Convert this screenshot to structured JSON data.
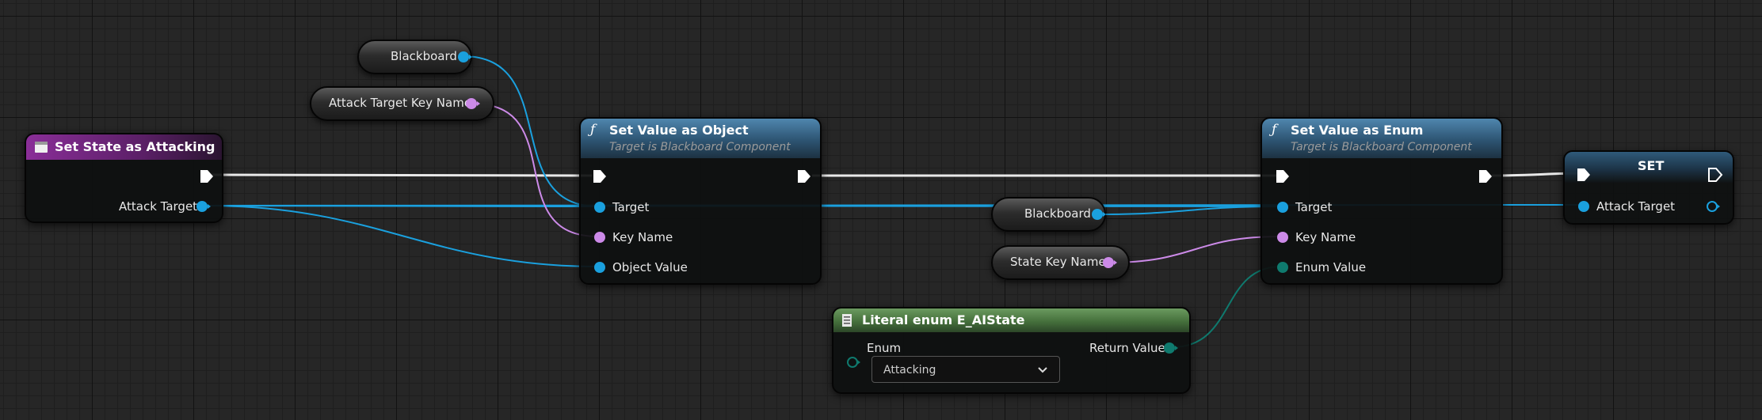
{
  "graph": {
    "colors": {
      "exec": "#e9e9e9",
      "object": "#1aa0de",
      "name": "#cc8ae8",
      "enum": "#0f7a6e",
      "custom_event_header": "#7a2a86",
      "function_header": "#3d6e90",
      "literal_enum_header": "#4e7a44"
    },
    "nodes": {
      "event": {
        "title": "Set State as Attacking",
        "icon": "event-icon",
        "output_pin": "Attack Target"
      },
      "blackboard_var_1": {
        "label": "Blackboard"
      },
      "attack_key_var": {
        "label": "Attack Target Key Name"
      },
      "set_object": {
        "title": "Set Value as Object",
        "subtitle": "Target is Blackboard Component",
        "icon": "function-icon",
        "pins": [
          "Target",
          "Key Name",
          "Object Value"
        ]
      },
      "blackboard_var_2": {
        "label": "Blackboard"
      },
      "state_key_var": {
        "label": "State Key Name"
      },
      "literal_enum": {
        "title": "Literal enum E_AIState",
        "icon": "enum-literal-icon",
        "input_pin": "Enum",
        "output_pin": "Return Value",
        "selected": "Attacking"
      },
      "set_enum": {
        "title": "Set Value as Enum",
        "subtitle": "Target is Blackboard Component",
        "icon": "function-icon",
        "pins": [
          "Target",
          "Key Name",
          "Enum Value"
        ]
      },
      "set_var": {
        "title": "SET",
        "pin": "Attack Target"
      }
    }
  }
}
